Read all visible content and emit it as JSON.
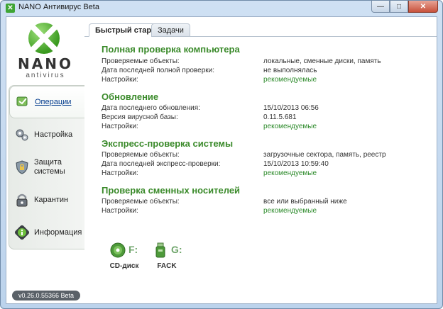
{
  "window": {
    "title": "NANO Антивирус Beta",
    "minimize": "—",
    "maximize": "□",
    "close": "✕"
  },
  "logo": {
    "name": "NANO",
    "subtitle": "antivirus"
  },
  "sidebar": {
    "items": [
      {
        "label": "Операции",
        "icon": "operations-icon",
        "active": true
      },
      {
        "label": "Настройка",
        "icon": "settings-gears-icon",
        "active": false
      },
      {
        "label": "Защита системы",
        "icon": "shield-lock-icon",
        "active": false
      },
      {
        "label": "Карантин",
        "icon": "quarantine-lock-icon",
        "active": false
      },
      {
        "label": "Информация",
        "icon": "info-icon",
        "active": false
      }
    ],
    "version": "v0.26.0.55366 Beta"
  },
  "tabs": [
    {
      "label": "Быстрый старт",
      "active": true
    },
    {
      "label": "Задачи",
      "active": false
    }
  ],
  "sections": {
    "full_scan": {
      "title": "Полная проверка компьютера",
      "rows": [
        {
          "key": "Проверяемые объекты:",
          "value": "локальные, сменные диски, память"
        },
        {
          "key": "Дата последней полной проверки:",
          "value": "не выполнялась"
        },
        {
          "key": "Настройки:",
          "value": "рекомендуемые"
        }
      ]
    },
    "update": {
      "title": "Обновление",
      "rows": [
        {
          "key": "Дата последнего обновления:",
          "value": "15/10/2013 06:56"
        },
        {
          "key": "Версия вирусной базы:",
          "value": "0.11.5.681"
        },
        {
          "key": "Настройки:",
          "value": "рекомендуемые"
        }
      ]
    },
    "express": {
      "title": "Экспресс-проверка системы",
      "rows": [
        {
          "key": "Проверяемые объекты:",
          "value": "загрузочные сектора, память, реестр"
        },
        {
          "key": "Дата последней экспресс-проверки:",
          "value": "15/10/2013 10:59:40"
        },
        {
          "key": "Настройки:",
          "value": "рекомендуемые"
        }
      ]
    },
    "removable": {
      "title": "Проверка сменных носителей",
      "rows": [
        {
          "key": "Проверяемые объекты:",
          "value": "все или выбранный ниже"
        },
        {
          "key": "Настройки:",
          "value": "рекомендуемые"
        }
      ]
    }
  },
  "drives": [
    {
      "letter": "F:",
      "label": "CD-диск",
      "icon": "cd-disc-icon"
    },
    {
      "letter": "G:",
      "label": "FACK",
      "icon": "usb-drive-icon"
    }
  ],
  "colors": {
    "accent_green": "#3a8a2a",
    "link_green": "#2c8a2a",
    "title_bar": "#cfe0f3"
  }
}
